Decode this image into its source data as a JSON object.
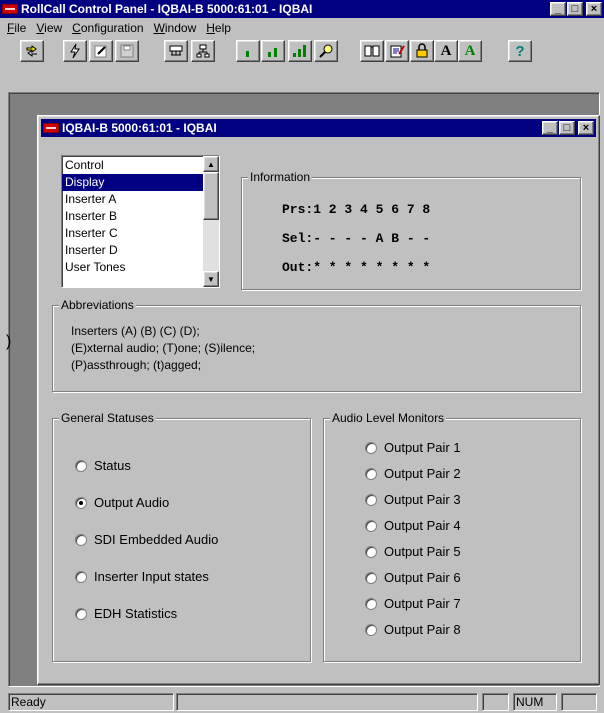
{
  "app": {
    "title": "RollCall Control Panel - IQBAI-B 5000:61:01 - IQBAI",
    "window_buttons": [
      "_",
      "□",
      "×"
    ]
  },
  "menubar": {
    "items": [
      {
        "label": "File",
        "accel": "F",
        "rest": "ile"
      },
      {
        "label": "View",
        "accel": "V",
        "rest": "iew"
      },
      {
        "label": "Configuration",
        "accel": "C",
        "rest": "onfiguration"
      },
      {
        "label": "Window",
        "accel": "W",
        "rest": "indow"
      },
      {
        "label": "Help",
        "accel": "H",
        "rest": "elp"
      }
    ]
  },
  "toolbar": {
    "buttons": [
      {
        "name": "connect-icon"
      },
      {
        "name": "lightning-icon"
      },
      {
        "name": "edit-icon"
      },
      {
        "name": "save-icon"
      },
      {
        "name": "network-icon"
      },
      {
        "name": "tree-icon"
      },
      {
        "name": "level-low-icon"
      },
      {
        "name": "level-mid-icon"
      },
      {
        "name": "level-high-icon"
      },
      {
        "name": "magnifier-icon"
      },
      {
        "name": "book-icon"
      },
      {
        "name": "notepad-icon"
      },
      {
        "name": "lock-icon"
      },
      {
        "name": "font-a-icon",
        "text": "A"
      },
      {
        "name": "font-a-green-icon",
        "text": "A"
      },
      {
        "name": "help-icon",
        "text": "?"
      }
    ]
  },
  "child_window": {
    "title": "IQBAI-B 5000:61:01 - IQBAI",
    "window_buttons": [
      "_",
      "□",
      "×"
    ]
  },
  "category_list": {
    "items": [
      "Control",
      "Display",
      "Inserter A",
      "Inserter B",
      "Inserter C",
      "Inserter D",
      "User Tones"
    ],
    "selected": "Display"
  },
  "information": {
    "title": "Information",
    "prs": "Prs:1 2 3 4 5 6 7 8",
    "sel": "Sel:- - - - A B - -",
    "out": "Out:* * * * * * * *"
  },
  "abbreviations": {
    "title": "Abbreviations",
    "lines": [
      "Inserters (A) (B) (C) (D);",
      "(E)xternal audio; (T)one; (S)ilence;",
      "(P)assthrough; (t)agged;"
    ]
  },
  "general_statuses": {
    "title": "General Statuses",
    "options": [
      "Status",
      "Output Audio",
      "SDI Embedded Audio",
      "Inserter Input states",
      "EDH Statistics"
    ],
    "selected": "Output Audio"
  },
  "audio_level_monitors": {
    "title": "Audio Level Monitors",
    "options": [
      "Output Pair 1",
      "Output Pair 2",
      "Output Pair 3",
      "Output Pair 4",
      "Output Pair 5",
      "Output Pair 6",
      "Output Pair 7",
      "Output Pair 8"
    ]
  },
  "statusbar": {
    "status": "Ready",
    "num": "NUM"
  },
  "colors": {
    "face": "#c0c0c0",
    "titlebar": "#000080",
    "selection": "#000080",
    "mdi_background": "#808080"
  }
}
